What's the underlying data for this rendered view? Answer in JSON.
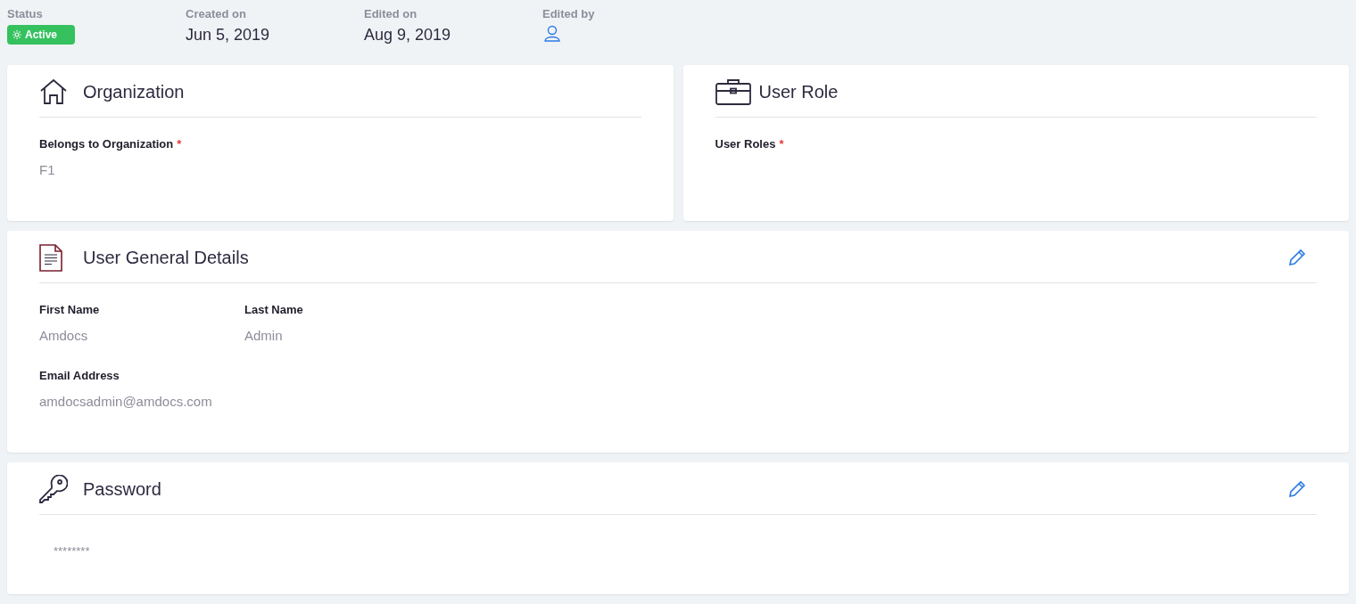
{
  "meta": [
    {
      "kind": "status",
      "label": "Status",
      "value": "Active",
      "active": true
    },
    {
      "kind": "text",
      "label": "Created on",
      "value": "Jun 5, 2019"
    },
    {
      "kind": "text",
      "label": "Edited on",
      "value": "Aug 9, 2019"
    },
    {
      "kind": "user",
      "label": "Edited by"
    }
  ],
  "top_cards": [
    {
      "title": "Organization",
      "rows": [
        [
          {
            "label": "Belongs to Organization",
            "required_mark": "*",
            "value": "F1"
          }
        ]
      ]
    },
    {
      "title": "User Role",
      "rows": [
        [
          {
            "label": "User Roles",
            "required_mark": "*"
          }
        ]
      ]
    }
  ],
  "cards": [
    {
      "title": "User General Details",
      "editable": true,
      "rows": [
        [
          {
            "label": "First Name",
            "value": "Amdocs"
          },
          {
            "label": "Last Name",
            "value": "Admin"
          }
        ],
        [
          {
            "label": "Email Address",
            "value": "amdocsadmin@amdocs.com"
          }
        ]
      ]
    },
    {
      "title": "Password",
      "editable": true,
      "rows": [
        [
          {
            "kind": "masked",
            "value": "********"
          }
        ]
      ]
    }
  ]
}
